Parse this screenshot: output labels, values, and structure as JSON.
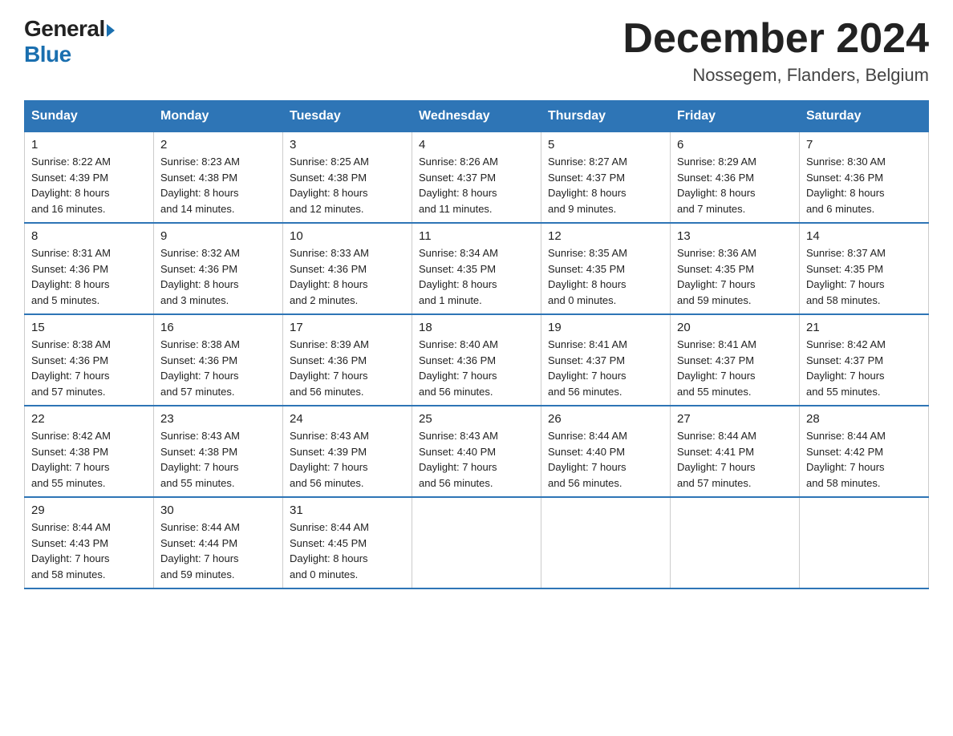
{
  "header": {
    "logo_line1": "General",
    "logo_line2": "Blue",
    "month_title": "December 2024",
    "location": "Nossegem, Flanders, Belgium"
  },
  "days_of_week": [
    "Sunday",
    "Monday",
    "Tuesday",
    "Wednesday",
    "Thursday",
    "Friday",
    "Saturday"
  ],
  "weeks": [
    [
      {
        "day": "1",
        "info": "Sunrise: 8:22 AM\nSunset: 4:39 PM\nDaylight: 8 hours\nand 16 minutes."
      },
      {
        "day": "2",
        "info": "Sunrise: 8:23 AM\nSunset: 4:38 PM\nDaylight: 8 hours\nand 14 minutes."
      },
      {
        "day": "3",
        "info": "Sunrise: 8:25 AM\nSunset: 4:38 PM\nDaylight: 8 hours\nand 12 minutes."
      },
      {
        "day": "4",
        "info": "Sunrise: 8:26 AM\nSunset: 4:37 PM\nDaylight: 8 hours\nand 11 minutes."
      },
      {
        "day": "5",
        "info": "Sunrise: 8:27 AM\nSunset: 4:37 PM\nDaylight: 8 hours\nand 9 minutes."
      },
      {
        "day": "6",
        "info": "Sunrise: 8:29 AM\nSunset: 4:36 PM\nDaylight: 8 hours\nand 7 minutes."
      },
      {
        "day": "7",
        "info": "Sunrise: 8:30 AM\nSunset: 4:36 PM\nDaylight: 8 hours\nand 6 minutes."
      }
    ],
    [
      {
        "day": "8",
        "info": "Sunrise: 8:31 AM\nSunset: 4:36 PM\nDaylight: 8 hours\nand 5 minutes."
      },
      {
        "day": "9",
        "info": "Sunrise: 8:32 AM\nSunset: 4:36 PM\nDaylight: 8 hours\nand 3 minutes."
      },
      {
        "day": "10",
        "info": "Sunrise: 8:33 AM\nSunset: 4:36 PM\nDaylight: 8 hours\nand 2 minutes."
      },
      {
        "day": "11",
        "info": "Sunrise: 8:34 AM\nSunset: 4:35 PM\nDaylight: 8 hours\nand 1 minute."
      },
      {
        "day": "12",
        "info": "Sunrise: 8:35 AM\nSunset: 4:35 PM\nDaylight: 8 hours\nand 0 minutes."
      },
      {
        "day": "13",
        "info": "Sunrise: 8:36 AM\nSunset: 4:35 PM\nDaylight: 7 hours\nand 59 minutes."
      },
      {
        "day": "14",
        "info": "Sunrise: 8:37 AM\nSunset: 4:35 PM\nDaylight: 7 hours\nand 58 minutes."
      }
    ],
    [
      {
        "day": "15",
        "info": "Sunrise: 8:38 AM\nSunset: 4:36 PM\nDaylight: 7 hours\nand 57 minutes."
      },
      {
        "day": "16",
        "info": "Sunrise: 8:38 AM\nSunset: 4:36 PM\nDaylight: 7 hours\nand 57 minutes."
      },
      {
        "day": "17",
        "info": "Sunrise: 8:39 AM\nSunset: 4:36 PM\nDaylight: 7 hours\nand 56 minutes."
      },
      {
        "day": "18",
        "info": "Sunrise: 8:40 AM\nSunset: 4:36 PM\nDaylight: 7 hours\nand 56 minutes."
      },
      {
        "day": "19",
        "info": "Sunrise: 8:41 AM\nSunset: 4:37 PM\nDaylight: 7 hours\nand 56 minutes."
      },
      {
        "day": "20",
        "info": "Sunrise: 8:41 AM\nSunset: 4:37 PM\nDaylight: 7 hours\nand 55 minutes."
      },
      {
        "day": "21",
        "info": "Sunrise: 8:42 AM\nSunset: 4:37 PM\nDaylight: 7 hours\nand 55 minutes."
      }
    ],
    [
      {
        "day": "22",
        "info": "Sunrise: 8:42 AM\nSunset: 4:38 PM\nDaylight: 7 hours\nand 55 minutes."
      },
      {
        "day": "23",
        "info": "Sunrise: 8:43 AM\nSunset: 4:38 PM\nDaylight: 7 hours\nand 55 minutes."
      },
      {
        "day": "24",
        "info": "Sunrise: 8:43 AM\nSunset: 4:39 PM\nDaylight: 7 hours\nand 56 minutes."
      },
      {
        "day": "25",
        "info": "Sunrise: 8:43 AM\nSunset: 4:40 PM\nDaylight: 7 hours\nand 56 minutes."
      },
      {
        "day": "26",
        "info": "Sunrise: 8:44 AM\nSunset: 4:40 PM\nDaylight: 7 hours\nand 56 minutes."
      },
      {
        "day": "27",
        "info": "Sunrise: 8:44 AM\nSunset: 4:41 PM\nDaylight: 7 hours\nand 57 minutes."
      },
      {
        "day": "28",
        "info": "Sunrise: 8:44 AM\nSunset: 4:42 PM\nDaylight: 7 hours\nand 58 minutes."
      }
    ],
    [
      {
        "day": "29",
        "info": "Sunrise: 8:44 AM\nSunset: 4:43 PM\nDaylight: 7 hours\nand 58 minutes."
      },
      {
        "day": "30",
        "info": "Sunrise: 8:44 AM\nSunset: 4:44 PM\nDaylight: 7 hours\nand 59 minutes."
      },
      {
        "day": "31",
        "info": "Sunrise: 8:44 AM\nSunset: 4:45 PM\nDaylight: 8 hours\nand 0 minutes."
      },
      {
        "day": "",
        "info": ""
      },
      {
        "day": "",
        "info": ""
      },
      {
        "day": "",
        "info": ""
      },
      {
        "day": "",
        "info": ""
      }
    ]
  ]
}
